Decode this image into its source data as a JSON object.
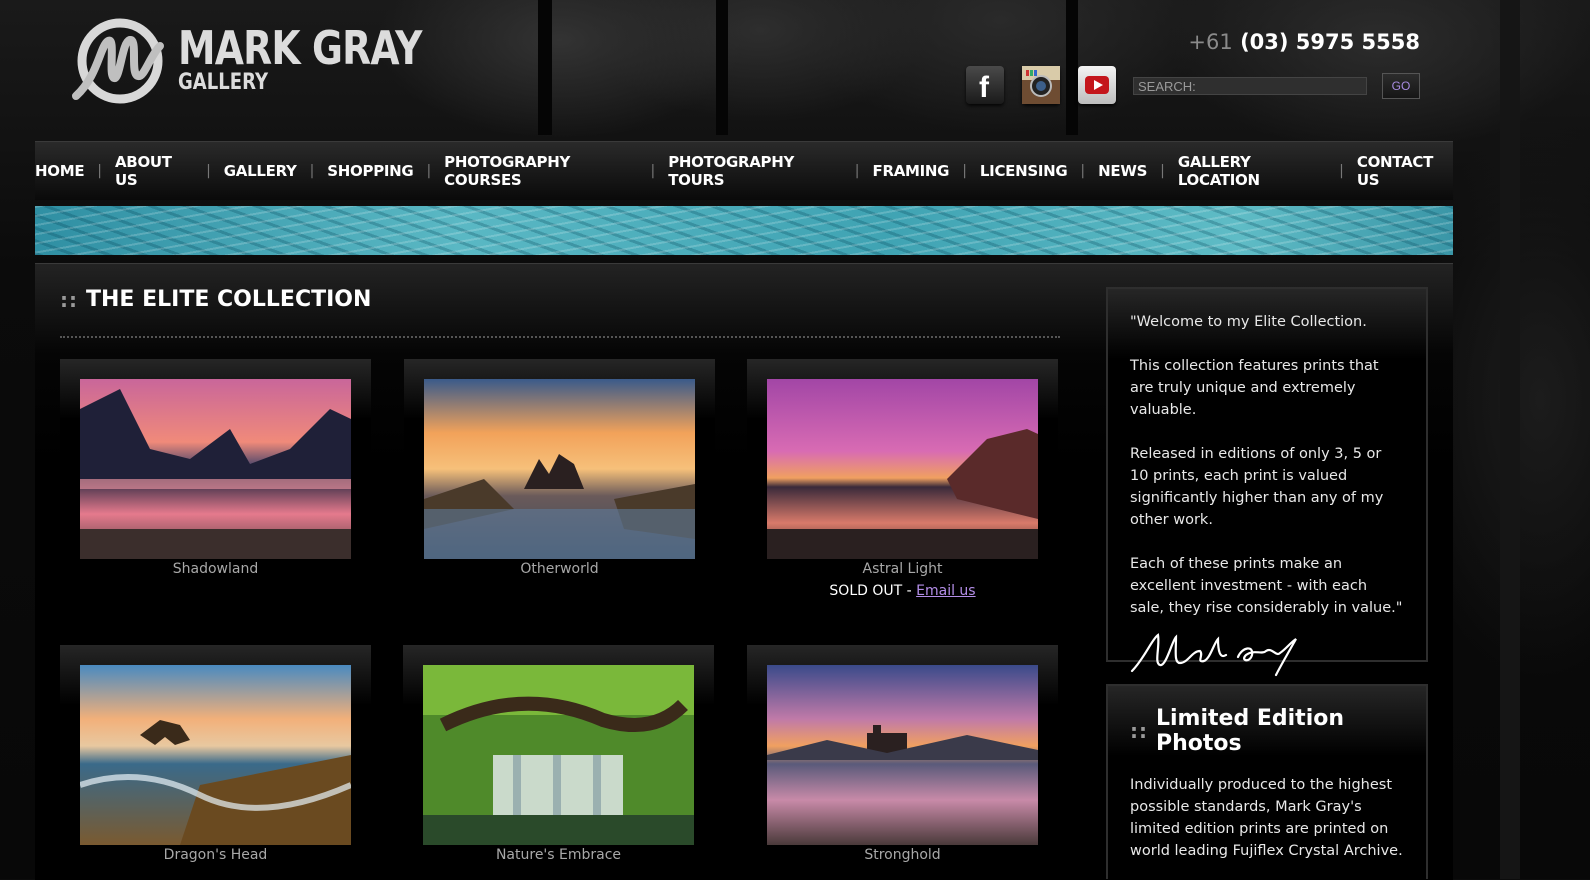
{
  "header": {
    "logo_title": "MARK GRAY",
    "logo_sub": "GALLERY",
    "phone_prefix": "+61",
    "phone_number": "(03) 5975 5558",
    "search_placeholder": "SEARCH:",
    "go_label": "GO"
  },
  "socials": [
    {
      "name": "facebook-icon",
      "glyph": "f"
    },
    {
      "name": "instagram-icon",
      "glyph": "◉"
    },
    {
      "name": "youtube-icon",
      "glyph": "▶"
    }
  ],
  "nav": {
    "items": [
      "HOME",
      "ABOUT US",
      "GALLERY",
      "SHOPPING",
      "PHOTOGRAPHY COURSES",
      "PHOTOGRAPHY TOURS",
      "FRAMING",
      "LICENSING",
      "NEWS",
      "GALLERY LOCATION",
      "CONTACT US"
    ],
    "separator": "|"
  },
  "main": {
    "title_dots": "::",
    "title": "THE ELITE COLLECTION",
    "photos": [
      {
        "caption": "Shadowland"
      },
      {
        "caption": "Otherworld"
      },
      {
        "caption": "Astral Light",
        "sold_out": "SOLD OUT - ",
        "email_link": "Email us"
      },
      {
        "caption": "Dragon's Head"
      },
      {
        "caption": "Nature's Embrace"
      },
      {
        "caption": "Stronghold"
      }
    ]
  },
  "sidebar": {
    "intro": [
      "\"Welcome to my Elite Collection.",
      "This collection features prints that are truly unique and extremely valuable.",
      "Released in editions of only 3, 5 or 10 prints, each print is valued significantly higher than any of my other work.",
      "Each of these prints make an excellent investment - with each sale, they rise considerably in value.\""
    ],
    "signature": "Mark Gray",
    "limited_dots": "::",
    "limited_title": "Limited Edition Photos",
    "limited_text": "Individually produced to the highest possible standards, Mark Gray's limited edition prints are printed on world leading Fujiflex Crystal Archive."
  }
}
